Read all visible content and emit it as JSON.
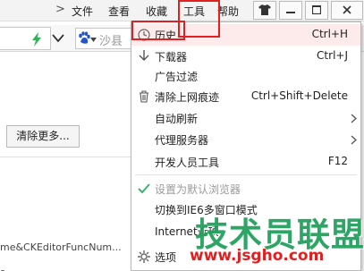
{
  "menubar": {
    "nav_arrow": ">",
    "items": [
      "文件",
      "查看",
      "收藏",
      "工具",
      "帮助"
    ],
    "window_buttons": [
      "shirt-icon",
      "minimize-icon",
      "maximize-icon",
      "close-icon"
    ]
  },
  "addressbar": {
    "search_text": "沙县"
  },
  "page": {
    "clear_more_label": "清除更多...",
    "url_row_1": "me&CKEditorFuncNum...",
    "url_row_2": "s"
  },
  "tools_menu": {
    "items": [
      {
        "label": "历史",
        "shortcut": "Ctrl+H",
        "icon": "history-clock-icon"
      },
      {
        "label": "下载器",
        "shortcut": "Ctrl+J",
        "icon": "download-arrow-icon"
      },
      {
        "label": "广告过滤",
        "shortcut": ""
      },
      {
        "label": "清除上网痕迹",
        "shortcut": "Ctrl+Shift+Delete",
        "icon": "trash-icon"
      },
      {
        "label": "自动刷新",
        "submenu": true
      },
      {
        "label": "代理服务器",
        "submenu": true
      },
      {
        "label": "开发人员工具",
        "shortcut": "F12"
      },
      {
        "label": "设置为默认浏览器",
        "disabled": true,
        "icon": "checkmark-icon"
      },
      {
        "label": "切换到IE6多窗口模式"
      },
      {
        "label": "Internet选项"
      },
      {
        "label": "选项",
        "icon": "gear-icon"
      }
    ]
  },
  "watermark": {
    "main": "技术员联盟",
    "sub": "www.jsgho.com"
  },
  "colors": {
    "highlight_border": "#e32020",
    "watermark_green": "#1ea05a",
    "check_green": "#3cb371"
  }
}
